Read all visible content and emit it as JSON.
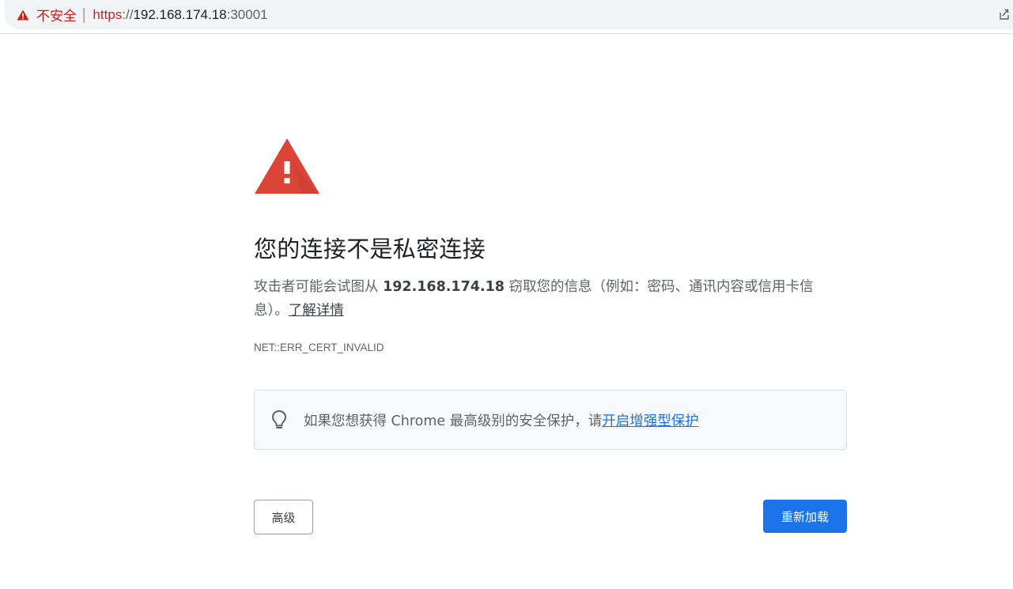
{
  "omnibox": {
    "security_label": "不安全",
    "url_scheme": "https",
    "url_separator": "://",
    "url_host": "192.168.174.18",
    "url_port": ":30001"
  },
  "interstitial": {
    "heading": "您的连接不是私密连接",
    "explanation_before": "攻击者可能会试图从 ",
    "explanation_host": "192.168.174.18",
    "explanation_after": " 窃取您的信息（例如：密码、通讯内容或信用卡信息）。",
    "learn_more": "了解详情",
    "error_code": "NET::ERR_CERT_INVALID",
    "tip_text": "如果您想获得 Chrome 最高级别的安全保护，请",
    "tip_link": "开启增强型保护",
    "advanced_button": "高级",
    "reload_button": "重新加载"
  },
  "colors": {
    "danger": "#c5221f",
    "warning_icon": "#db4437",
    "primary": "#1a73e8",
    "text_secondary": "#5f6368"
  },
  "icons": {
    "omnibox_warning": "warning-triangle-icon",
    "big_warning": "warning-triangle-icon",
    "tip": "lightbulb-icon",
    "page_action": "share-icon"
  }
}
